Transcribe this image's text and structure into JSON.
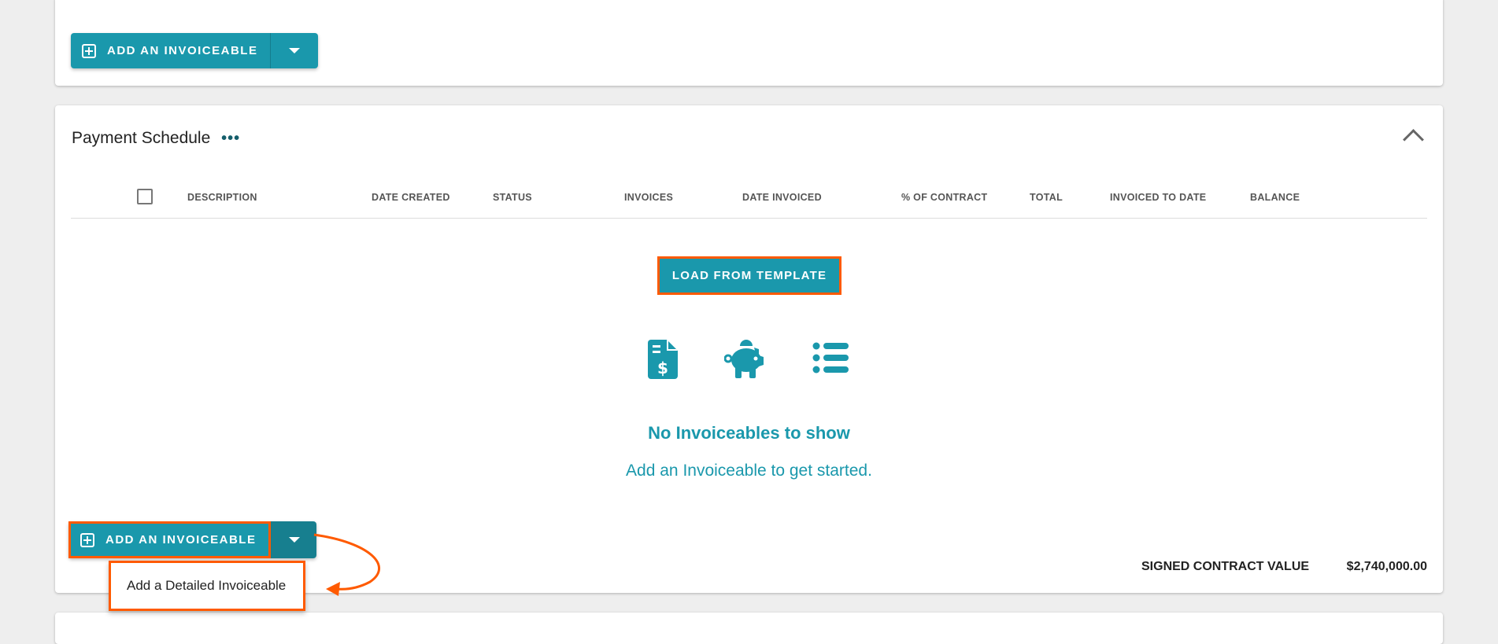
{
  "top_card": {
    "add_button_label": "ADD AN INVOICEABLE"
  },
  "payment_schedule": {
    "title": "Payment Schedule",
    "more_label": "•••",
    "columns": [
      "DESCRIPTION",
      "DATE CREATED",
      "STATUS",
      "INVOICES",
      "DATE INVOICED",
      "% OF CONTRACT",
      "TOTAL",
      "INVOICED TO DATE",
      "BALANCE"
    ],
    "load_template_label": "LOAD FROM TEMPLATE",
    "empty_title": "No Invoiceables to show",
    "empty_subtitle": "Add an Invoiceable to get started.",
    "add_button_label": "ADD AN INVOICEABLE",
    "dropdown_items": [
      "Add a Detailed Invoiceable"
    ],
    "signed_contract_label": "SIGNED CONTRACT VALUE",
    "signed_contract_value": "$2,740,000.00"
  },
  "colors": {
    "accent": "#1a98ac",
    "highlight": "#ff5a00",
    "background": "#eeeeee"
  }
}
